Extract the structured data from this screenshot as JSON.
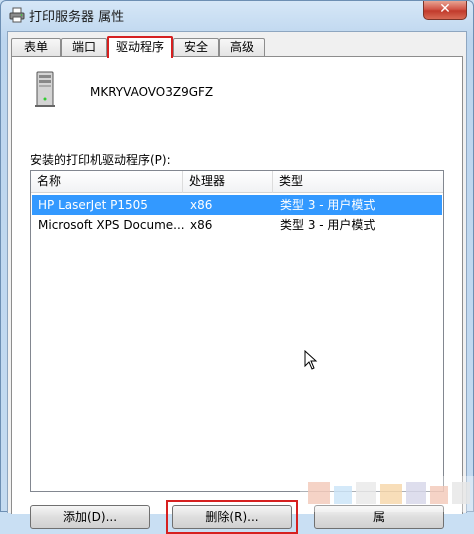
{
  "window": {
    "title": "打印服务器 属性",
    "close_label": "✕",
    "icon": "printer-icon"
  },
  "tabs": [
    {
      "label": "表单",
      "active": false
    },
    {
      "label": "端口",
      "active": false
    },
    {
      "label": "驱动程序",
      "active": true
    },
    {
      "label": "安全",
      "active": false
    },
    {
      "label": "高级",
      "active": false
    }
  ],
  "server": {
    "name": "MKRYVAOVO3Z9GFZ",
    "icon": "server-icon"
  },
  "drivers": {
    "label": "安装的打印机驱动程序(P):",
    "columns": [
      "名称",
      "处理器",
      "类型"
    ],
    "rows": [
      {
        "name": "HP LaserJet P1505",
        "processor": "x86",
        "type": "类型 3 - 用户模式",
        "selected": true
      },
      {
        "name": "Microsoft XPS Docume...",
        "processor": "x86",
        "type": "类型 3 - 用户模式",
        "selected": false
      }
    ]
  },
  "buttons": {
    "add": "添加(D)...",
    "remove": "删除(R)...",
    "properties": "属"
  },
  "colors": {
    "highlight_border": "#d62020",
    "selection": "#3399ff"
  }
}
